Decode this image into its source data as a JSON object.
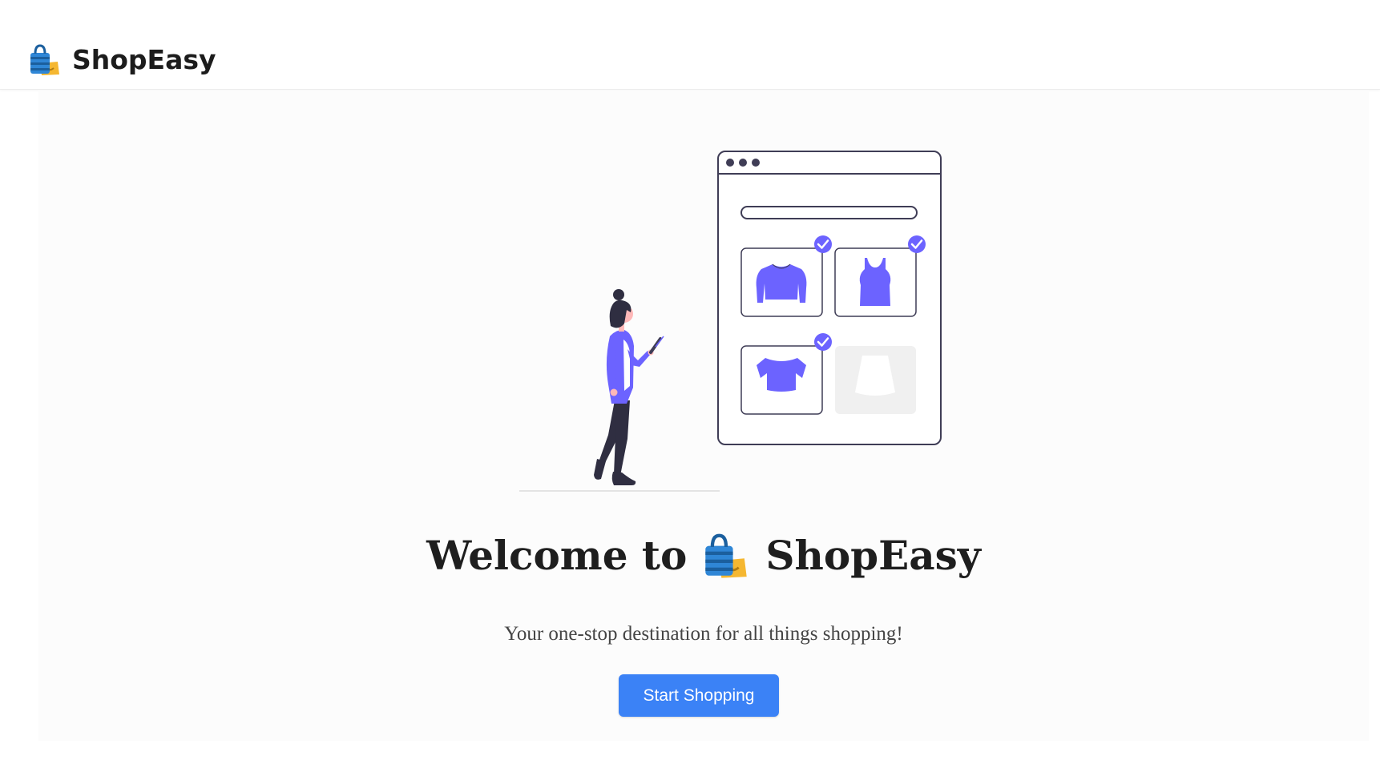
{
  "brand": {
    "name": "ShopEasy",
    "icon": "shopping-bags-icon"
  },
  "hero": {
    "title_prefix": "Welcome to",
    "title_name": "ShopEasy",
    "subtitle": "Your one-stop destination for all things shopping!",
    "cta_label": "Start Shopping"
  },
  "colors": {
    "accent": "#3b82f6",
    "illustration_primary": "#6c63ff",
    "text_dark": "#1e1e1e"
  }
}
